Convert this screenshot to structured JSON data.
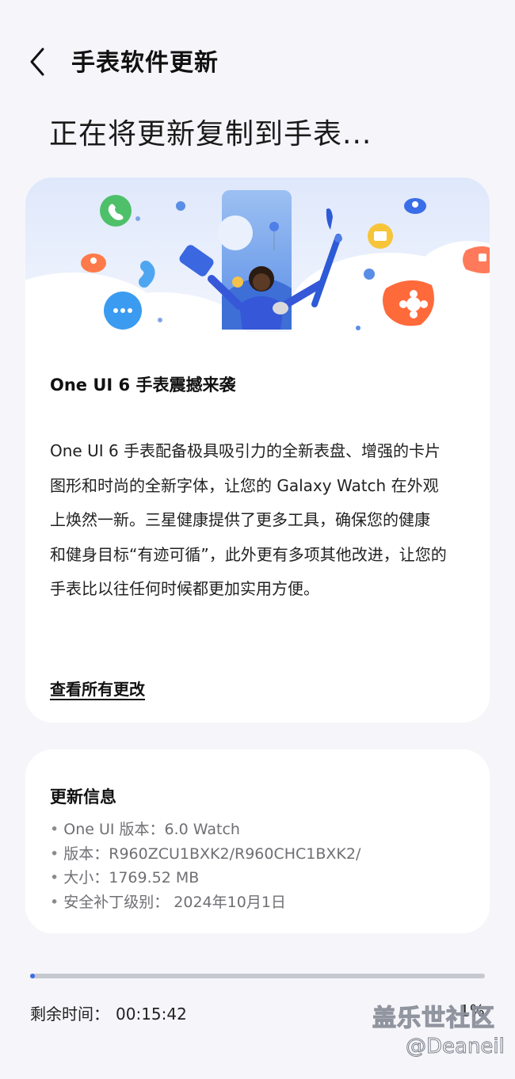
{
  "header": {
    "title": "手表软件更新"
  },
  "status": {
    "text": "正在将更新复制到手表..."
  },
  "feature": {
    "title": "One UI 6 手表震撼来袭",
    "body_lines": [
      "One UI 6 手表配备极具吸引力的全新表盘、增强的卡片",
      "图形和时尚的全新字体，让您的 Galaxy Watch 在外观",
      "上焕然一新。三星健康提供了更多工具，确保您的健康",
      "和健身目标“有迹可循”，此外更有多项其他改进，让您的",
      "手表比以往任何时候都更加实用方便。"
    ],
    "see_all": "查看所有更改"
  },
  "info": {
    "title": "更新信息",
    "items": [
      "One UI 版本：6.0 Watch",
      "版本：R960ZCU1BXK2/R960CHC1BXK2/",
      "大小：1769.52 MB",
      "安全补丁级别： 2024年10月1日"
    ]
  },
  "progress": {
    "fraction": 0.01,
    "remaining_label": "剩余时间：",
    "remaining_value": "00:15:42",
    "percent_text": "1%"
  },
  "watermark": {
    "site": "盖乐世社区",
    "user": "@Deaneil"
  },
  "colors": {
    "accent": "#3a6ee8",
    "track": "#c7c8cf",
    "card": "#ffffff",
    "background": "#f6f6fa"
  },
  "icons": [
    "back-chevron-icon",
    "phone-call-icon",
    "location-pin-icon",
    "message-bubble-icon",
    "folder-icon",
    "flower-icon",
    "cloud-icon",
    "camera-icon"
  ]
}
